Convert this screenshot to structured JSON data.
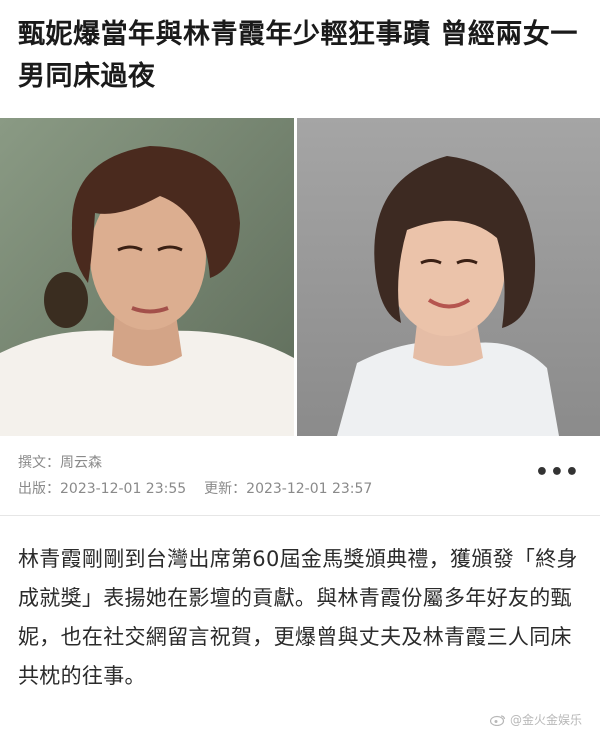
{
  "article": {
    "title": "甄妮爆當年與林青霞年少輕狂事蹟 曾經兩女一男同床過夜",
    "author_label": "撰文：",
    "author": "周云森",
    "published_label": "出版：",
    "published": "2023-12-01 23:55",
    "updated_label": "更新：",
    "updated": "2023-12-01 23:57",
    "more_label": "•••",
    "body": "林青霞剛剛到台灣出席第60屆金馬獎頒典禮，獲頒發「終身成就獎」表揚她在影壇的貢獻。與林青霞份屬多年好友的甄妮，也在社交網留言祝賀，更爆曾與丈夫及林青霞三人同床共枕的往事。"
  },
  "hero": {
    "left_photo": "portrait-photo",
    "right_photo": "portrait-photo"
  },
  "watermark": {
    "icon": "weibo-icon",
    "text": "@金火金娱乐"
  }
}
